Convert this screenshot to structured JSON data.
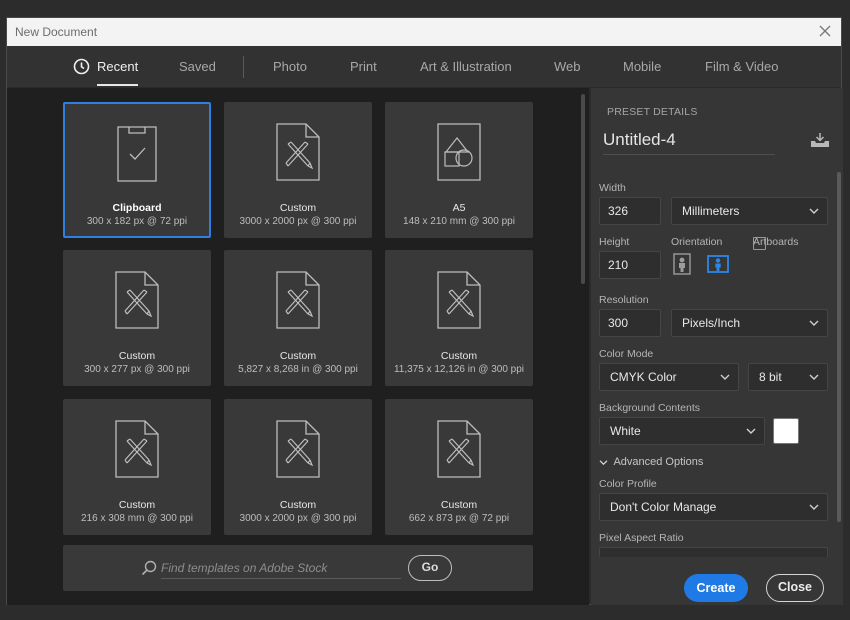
{
  "window": {
    "title": "New Document",
    "close_icon": "close-icon"
  },
  "tabs": [
    {
      "label": "Recent",
      "active": true,
      "icon": "clock-icon"
    },
    {
      "label": "Saved"
    },
    {
      "label": "Photo"
    },
    {
      "label": "Print"
    },
    {
      "label": "Art & Illustration"
    },
    {
      "label": "Web"
    },
    {
      "label": "Mobile"
    },
    {
      "label": "Film & Video"
    }
  ],
  "presets": [
    {
      "name": "Clipboard",
      "dims": "300 x 182 px @ 72 ppi",
      "icon": "clipboard-icon",
      "selected": true
    },
    {
      "name": "Custom",
      "dims": "3000 x 2000 px @ 300 ppi",
      "icon": "custom-document-icon"
    },
    {
      "name": "A5",
      "dims": "148 x 210 mm @ 300 ppi",
      "icon": "shapes-document-icon"
    },
    {
      "name": "Custom",
      "dims": "300 x 277 px @ 300 ppi",
      "icon": "custom-document-icon"
    },
    {
      "name": "Custom",
      "dims": "5,827 x 8,268 in @ 300 ppi",
      "icon": "custom-document-icon"
    },
    {
      "name": "Custom",
      "dims": "11,375 x 12,126 in @ 300 ppi",
      "icon": "custom-document-icon"
    },
    {
      "name": "Custom",
      "dims": "216 x 308 mm @ 300 ppi",
      "icon": "custom-document-icon"
    },
    {
      "name": "Custom",
      "dims": "3000 x 2000 px @ 300 ppi",
      "icon": "custom-document-icon"
    },
    {
      "name": "Custom",
      "dims": "662 x 873 px @ 72 ppi",
      "icon": "custom-document-icon"
    }
  ],
  "search": {
    "placeholder": "Find templates on Adobe Stock",
    "value": "",
    "go_label": "Go"
  },
  "details": {
    "header": "PRESET DETAILS",
    "doc_name": "Untitled-4",
    "width_label": "Width",
    "width_value": "326",
    "width_unit": "Millimeters",
    "height_label": "Height",
    "height_value": "210",
    "orientation_label": "Orientation",
    "orientation_selected": "landscape",
    "artboards_label": "Artboards",
    "artboards_checked": false,
    "resolution_label": "Resolution",
    "resolution_value": "300",
    "resolution_unit": "Pixels/Inch",
    "color_mode_label": "Color Mode",
    "color_mode": "CMYK Color",
    "bit_depth": "8 bit",
    "bg_label": "Background Contents",
    "bg_value": "White",
    "bg_swatch_color": "#ffffff",
    "advanced_label": "Advanced Options",
    "color_profile_label": "Color Profile",
    "color_profile": "Don't Color Manage",
    "pixel_aspect_label": "Pixel Aspect Ratio"
  },
  "buttons": {
    "create": "Create",
    "close": "Close"
  },
  "colors": {
    "accent": "#1f7ae6",
    "selected_border": "#2e80e0"
  }
}
